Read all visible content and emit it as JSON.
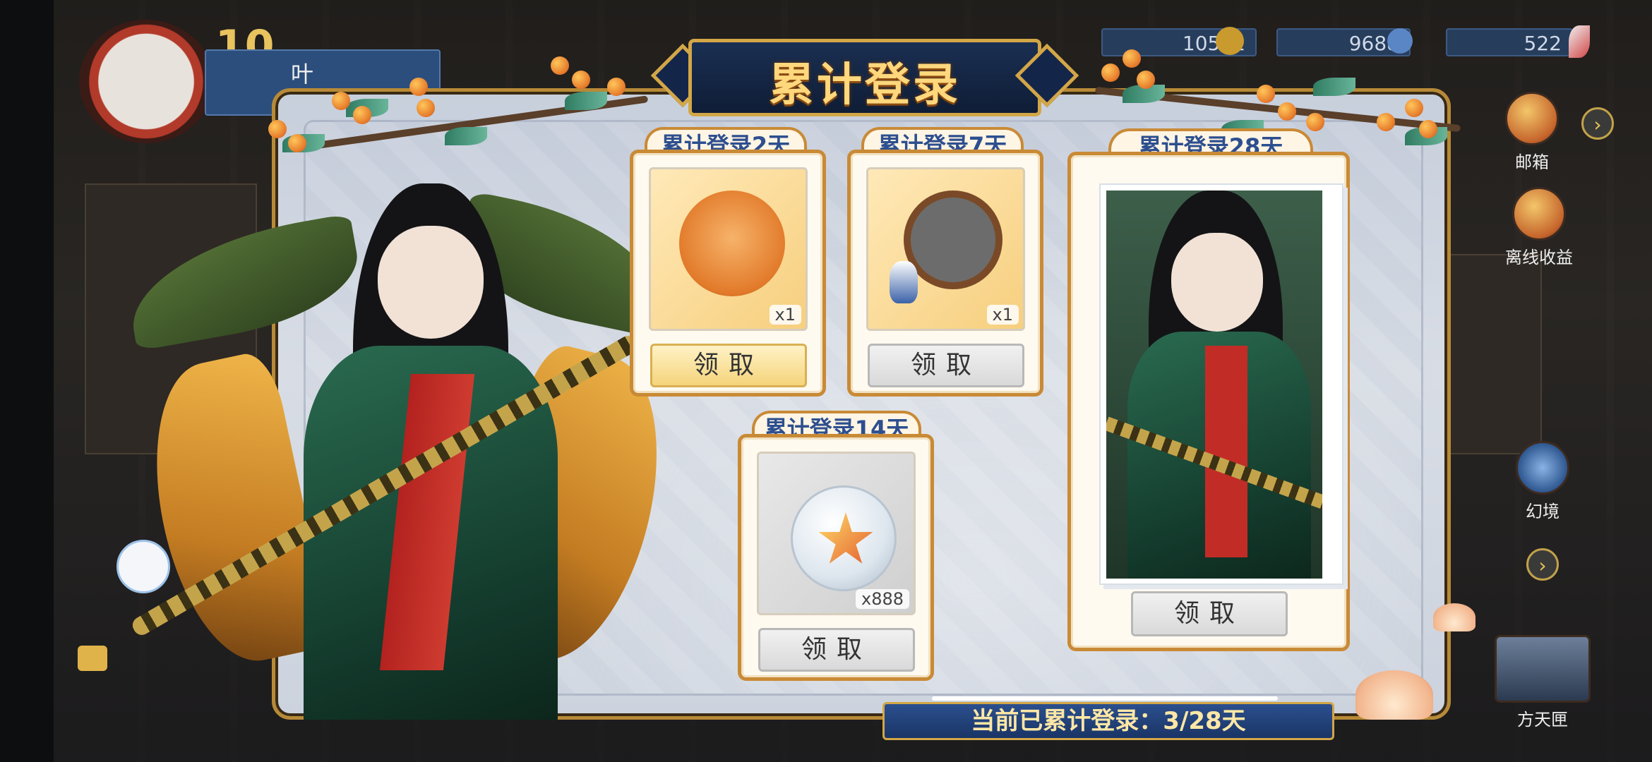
{
  "hud": {
    "player_level": "10",
    "player_name_partial": "叶",
    "currency": [
      {
        "value": "10511",
        "icon": "gold-coin-icon"
      },
      {
        "value": "9688",
        "icon": "blue-gem-icon"
      },
      {
        "value": "522",
        "icon": "feather-icon"
      }
    ],
    "mail_label": "邮箱",
    "offline_label": "离线收益",
    "phantom_label": "幻境",
    "chest_label": "方天匣"
  },
  "dialog": {
    "title": "累计登录",
    "rewards": [
      {
        "tab": "累计登录2天",
        "qty": "x1",
        "claim": "领取",
        "item_icon": "monkey-avatar-icon",
        "style": "gold"
      },
      {
        "tab": "累计登录7天",
        "qty": "x1",
        "claim": "领取",
        "item_icon": "portrait-frame-icon",
        "style": "grey"
      },
      {
        "tab": "累计登录14天",
        "qty": "x888",
        "claim": "领取",
        "item_icon": "star-bottle-icon",
        "style": "grey"
      },
      {
        "tab": "累计登录28天",
        "qty": "",
        "claim": "领取",
        "item_icon": "character-card-icon",
        "style": "grey"
      }
    ],
    "status": "当前已累计登录：3/28天"
  },
  "colors": {
    "accent_gold": "#d3a647",
    "banner_blue": "#1a2f52",
    "tab_text": "#2d4f8f"
  }
}
